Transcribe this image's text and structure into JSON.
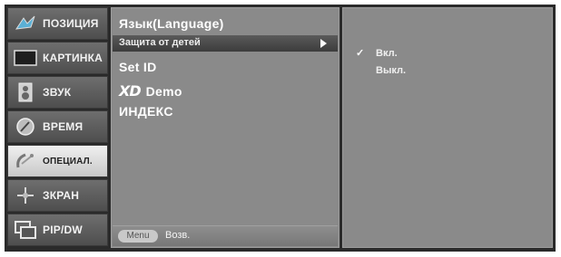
{
  "menu": {
    "items": [
      {
        "label": "ПОЗИЦИЯ",
        "icon": "position-icon"
      },
      {
        "label": "КАРТИНКА",
        "icon": "picture-icon"
      },
      {
        "label": "ЗВУК",
        "icon": "speaker-icon"
      },
      {
        "label": "ВРЕМЯ",
        "icon": "clock-icon"
      },
      {
        "label": "ОПЕЦИАЛ.",
        "icon": "satellite-dish-icon",
        "active": true
      },
      {
        "label": "ЗКРАН",
        "icon": "screen-adjust-icon"
      },
      {
        "label": "PIP/DW",
        "icon": "pip-icon"
      }
    ]
  },
  "submenu": {
    "language": "Язык(Language)",
    "child_lock": "Защита от детей",
    "set_id": "Set ID",
    "xd_logo": "XD",
    "xd_demo": "Demo",
    "index": "ИНДЕКС"
  },
  "options": {
    "on": "Вкл.",
    "off": "Выкл.",
    "checkmark": "✓"
  },
  "footer": {
    "menu_button": "Menu",
    "back_label": "Возв."
  }
}
